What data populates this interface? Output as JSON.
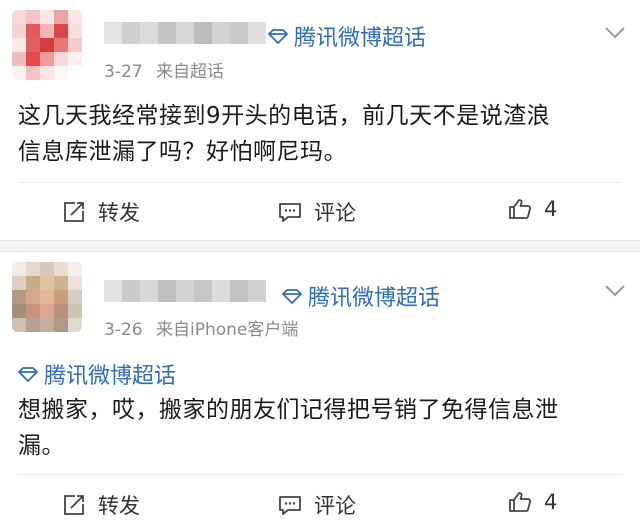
{
  "posts": [
    {
      "date": "3-27",
      "source": "来自超话",
      "topic_badge": "腾讯微博超话",
      "content_line1": "这几天我经常接到9开头的电话，前几天不是说渣浪",
      "content_line2": "信息库泄漏了吗？好怕啊尼玛。",
      "repost_label": "转发",
      "comment_label": "评论",
      "like_count": "4"
    },
    {
      "date": "3-26",
      "source": "来自iPhone客户端",
      "topic_badge": "腾讯微博超话",
      "topic_link": "腾讯微博超话",
      "content_line1": "想搬家，哎，搬家的朋友们记得把号销了免得信息泄",
      "content_line2": "漏。",
      "repost_label": "转发",
      "comment_label": "评论",
      "like_count": "4"
    }
  ],
  "icons": {
    "topic": "diamond-topic-icon",
    "repost": "repost-icon",
    "comment": "comment-icon",
    "like": "thumbs-up-icon",
    "menu": "chevron-down-icon"
  },
  "colors": {
    "accent": "#2f6db6",
    "meta": "#8a8a8a",
    "separator": "#f2f2f2"
  }
}
